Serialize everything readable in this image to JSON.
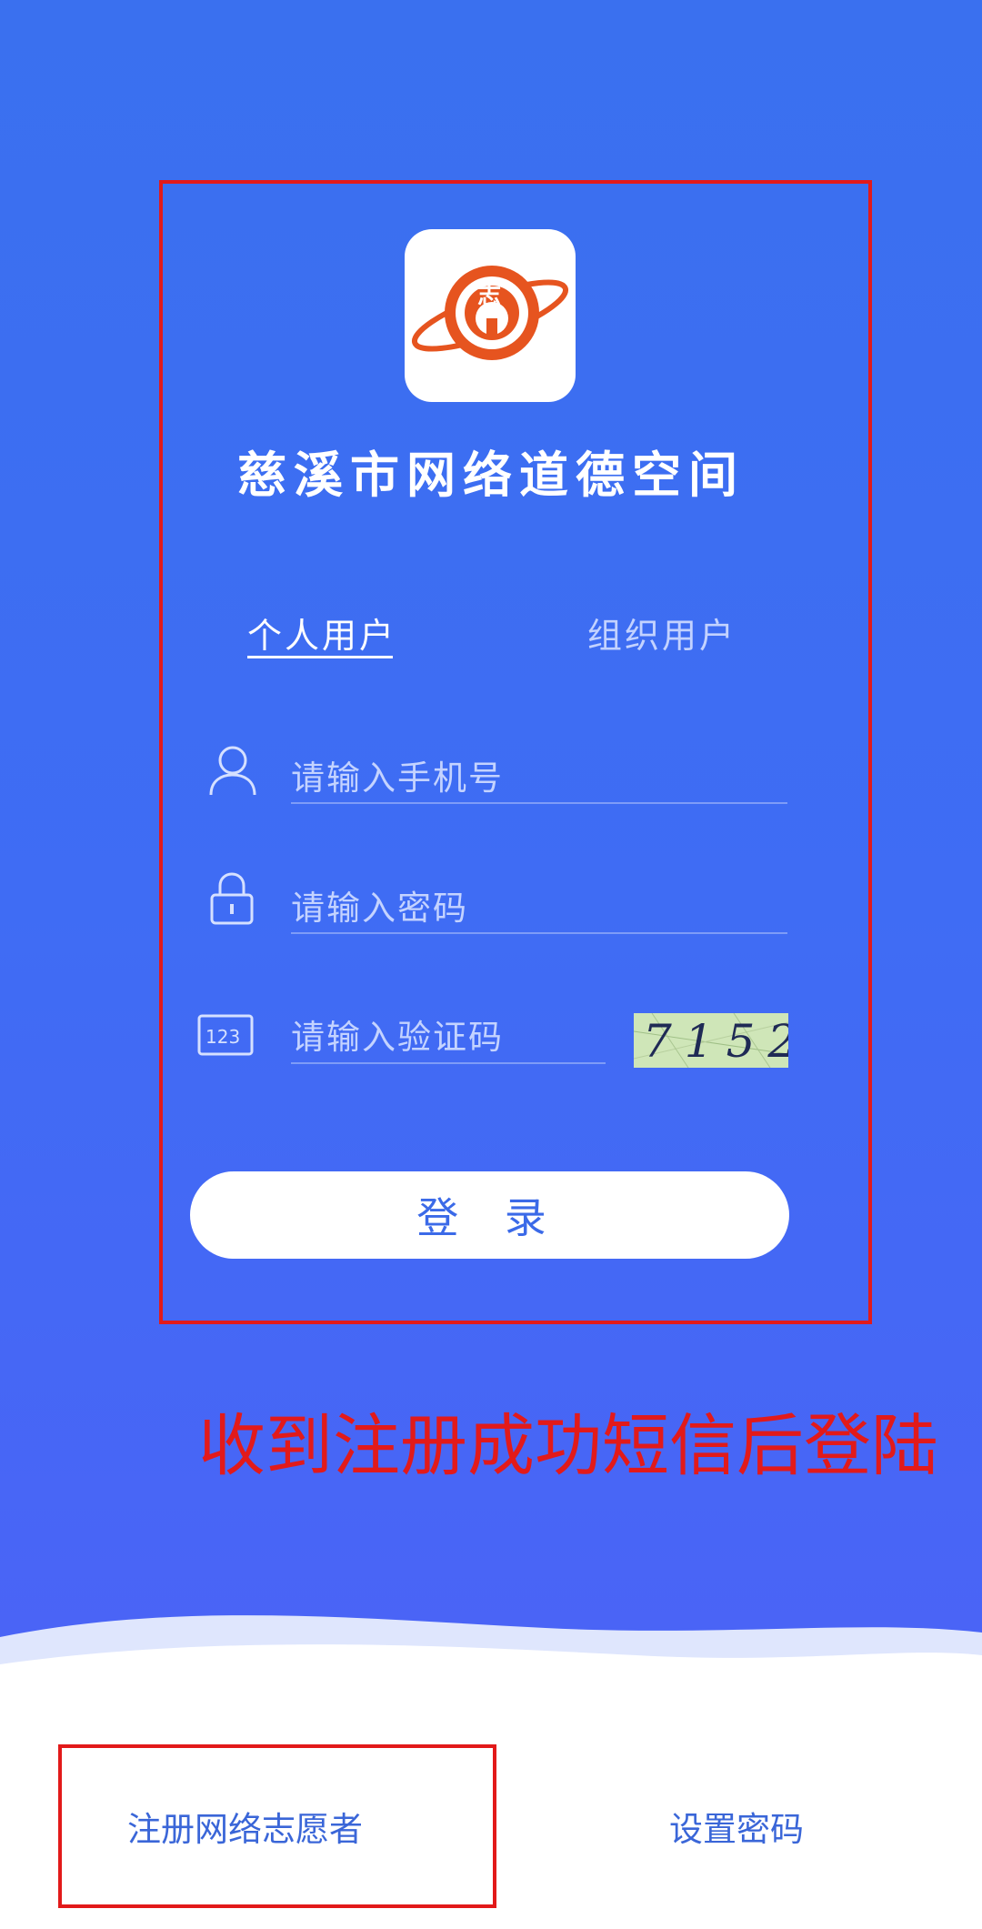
{
  "app": {
    "title": "慈溪市网络道德空间",
    "logo_icon": "volunteer-planet-logo"
  },
  "tabs": [
    {
      "label": "个人用户",
      "active": true
    },
    {
      "label": "组织用户",
      "active": false
    }
  ],
  "form": {
    "phone_placeholder": "请输入手机号",
    "password_placeholder": "请输入密码",
    "captcha_placeholder": "请输入验证码",
    "captcha_code": "7152",
    "login_label": "登 录"
  },
  "annotation": "收到注册成功短信后登陆",
  "footer": {
    "register_label": "注册网络志愿者",
    "set_password_label": "设置密码"
  },
  "colors": {
    "background": "#3f6cf4",
    "annotation": "#e21a1a",
    "button_text": "#3b6ae8"
  }
}
